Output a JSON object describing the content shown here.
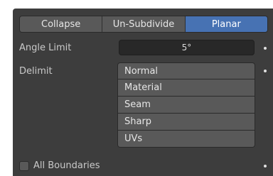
{
  "mode_buttons": [
    {
      "label": "Collapse",
      "active": false
    },
    {
      "label": "Un-Subdivide",
      "active": false
    },
    {
      "label": "Planar",
      "active": true
    }
  ],
  "angle_limit": {
    "label": "Angle Limit",
    "value": "5°"
  },
  "delimit": {
    "label": "Delimit",
    "options": [
      "Normal",
      "Material",
      "Seam",
      "Sharp",
      "UVs"
    ]
  },
  "all_boundaries": {
    "label": "All Boundaries",
    "checked": false
  },
  "colors": {
    "panel_bg": "#3d3d3d",
    "button_bg": "#595959",
    "active_accent": "#4772b3",
    "field_bg": "#282828"
  }
}
